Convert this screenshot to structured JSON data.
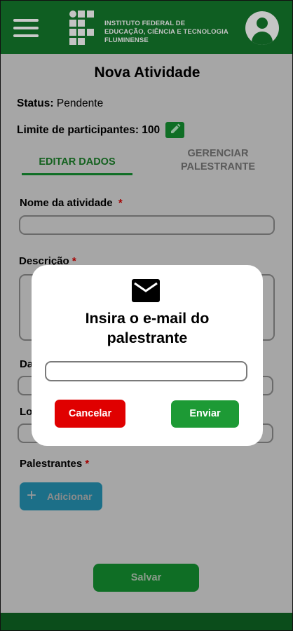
{
  "header": {
    "institution_line1": "INSTITUTO FEDERAL DE",
    "institution_line2": "EDUCAÇÃO, CIÊNCIA E TECNOLOGIA",
    "institution_line3": "FLUMINENSE",
    "menu_icon": "hamburger-icon",
    "profile_icon": "user-avatar-icon"
  },
  "page": {
    "title": "Nova Atividade",
    "status_label": "Status:",
    "status_value": "Pendente",
    "limit_label": "Limite de participantes:",
    "limit_value": "100",
    "edit_icon": "pencil-icon"
  },
  "tabs": {
    "active": "EDITAR DADOS",
    "inactive_line1": "GERENCIAR",
    "inactive_line2": "PALESTRANTE"
  },
  "form": {
    "name_label": "Nome da atividade",
    "description_label": "Descrição",
    "date_label_partial": "Da",
    "location_label_partial": "Lo",
    "speakers_label": "Palestrantes",
    "required_mark": "*",
    "add_button": "Adicionar",
    "save_button": "Salvar"
  },
  "modal": {
    "icon": "envelope-icon",
    "title_line1": "Insira o e-mail do",
    "title_line2": "palestrante",
    "email_value": "",
    "cancel_button": "Cancelar",
    "send_button": "Enviar"
  },
  "colors": {
    "header_green": "#0f5e22",
    "cancel_red": "#e00000",
    "send_green": "#1d9a35",
    "add_blue": "#1c6f88"
  }
}
